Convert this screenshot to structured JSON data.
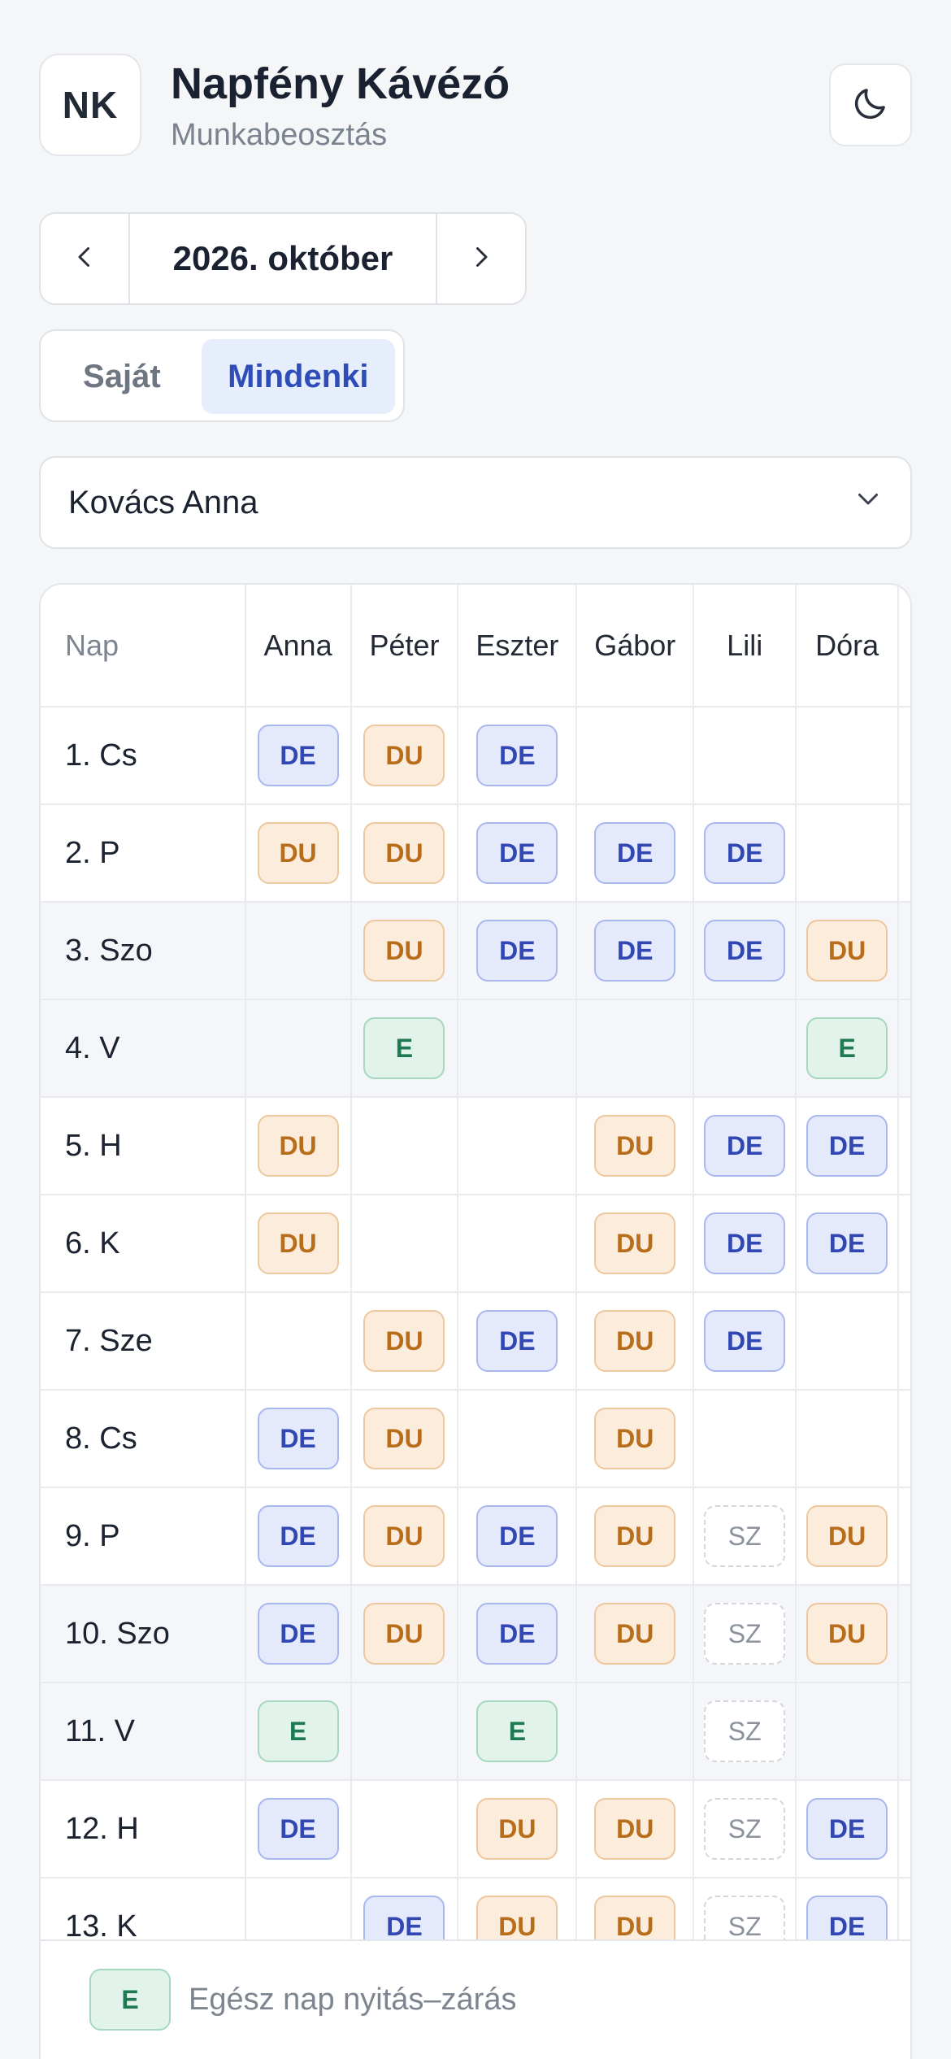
{
  "header": {
    "logo_initials": "NK",
    "title": "Napfény Kávézó",
    "subtitle": "Munkabeosztás",
    "theme_icon": "moon-icon"
  },
  "month_nav": {
    "label": "2026. október",
    "prev_icon": "chevron-left-icon",
    "next_icon": "chevron-right-icon"
  },
  "view_toggle": {
    "options": [
      "Saját",
      "Mindenki"
    ],
    "selected": "Mindenki"
  },
  "employee_select": {
    "value": "Kovács Anna",
    "icon": "chevron-down-icon"
  },
  "schedule": {
    "day_header": "Nap",
    "employees": [
      "Anna",
      "Péter",
      "Eszter",
      "Gábor",
      "Lili",
      "Dóra"
    ],
    "rows": [
      {
        "day": "1. Cs",
        "weekend": false,
        "shifts": [
          "DE",
          "DU",
          "DE",
          "",
          "",
          ""
        ]
      },
      {
        "day": "2. P",
        "weekend": false,
        "shifts": [
          "DU",
          "DU",
          "DE",
          "DE",
          "DE",
          ""
        ]
      },
      {
        "day": "3. Szo",
        "weekend": true,
        "shifts": [
          "",
          "DU",
          "DE",
          "DE",
          "DE",
          "DU"
        ]
      },
      {
        "day": "4. V",
        "weekend": true,
        "shifts": [
          "",
          "E",
          "",
          "",
          "",
          "E"
        ]
      },
      {
        "day": "5. H",
        "weekend": false,
        "shifts": [
          "DU",
          "",
          "",
          "DU",
          "DE",
          "DE"
        ]
      },
      {
        "day": "6. K",
        "weekend": false,
        "shifts": [
          "DU",
          "",
          "",
          "DU",
          "DE",
          "DE"
        ]
      },
      {
        "day": "7. Sze",
        "weekend": false,
        "shifts": [
          "",
          "DU",
          "DE",
          "DU",
          "DE",
          ""
        ]
      },
      {
        "day": "8. Cs",
        "weekend": false,
        "shifts": [
          "DE",
          "DU",
          "",
          "DU",
          "",
          ""
        ]
      },
      {
        "day": "9. P",
        "weekend": false,
        "shifts": [
          "DE",
          "DU",
          "DE",
          "DU",
          "SZ",
          "DU"
        ]
      },
      {
        "day": "10. Szo",
        "weekend": true,
        "shifts": [
          "DE",
          "DU",
          "DE",
          "DU",
          "SZ",
          "DU"
        ]
      },
      {
        "day": "11. V",
        "weekend": true,
        "shifts": [
          "E",
          "",
          "E",
          "",
          "SZ",
          ""
        ]
      },
      {
        "day": "12. H",
        "weekend": false,
        "shifts": [
          "DE",
          "",
          "DU",
          "DU",
          "SZ",
          "DE"
        ]
      },
      {
        "day": "13. K",
        "weekend": false,
        "shifts": [
          "",
          "DE",
          "DU",
          "DU",
          "SZ",
          "DE"
        ]
      }
    ]
  },
  "legend": {
    "badge": "E",
    "label": "Egész nap nyitás–zárás"
  },
  "colors": {
    "DE": "#3148b4",
    "DU": "#b86d1b",
    "E": "#1f7a52",
    "SZ": "#8b929c",
    "accent": "#2e4db8"
  }
}
